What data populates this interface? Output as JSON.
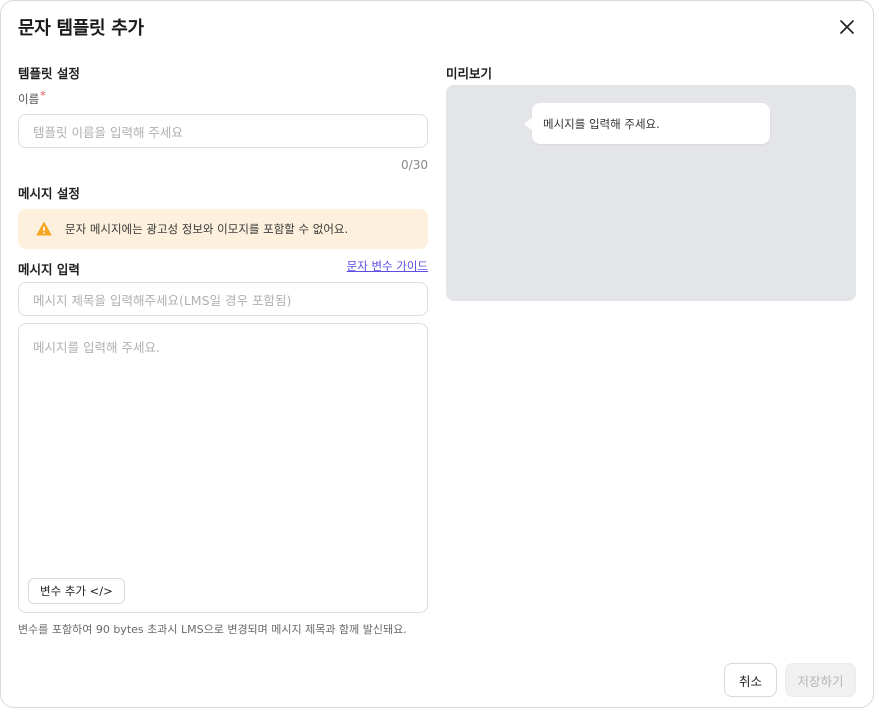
{
  "dialog": {
    "title": "문자 템플릿 추가"
  },
  "template_settings": {
    "heading": "템플릿 설정",
    "name_label": "이름",
    "required_mark": "*",
    "name_placeholder": "템플릿 이름을 입력해 주세요",
    "name_value": "",
    "counter": "0/30"
  },
  "message_settings": {
    "heading": "메시지 설정",
    "notice": "문자 메시지에는 광고성 정보와 이모지를 포함할 수 없어요.",
    "input_heading": "메시지 입력",
    "guide_link": "문자 변수 가이드",
    "subject_placeholder": "메시지 제목을 입력해주세요(LMS일 경우 포함됨)",
    "subject_value": "",
    "body_placeholder": "메시지를 입력해 주세요.",
    "body_value": "",
    "variable_button": "변수 추가 </>",
    "helper_text": "변수를 포함하여 90 bytes 초과시 LMS으로 변경되며 메시지 제목과 함께 발신돼요."
  },
  "preview": {
    "heading": "미리보기",
    "bubble_text": "메시지를 입력해 주세요."
  },
  "footer": {
    "cancel_label": "취소",
    "save_label": "저장하기"
  },
  "icons": {
    "close": "close-icon",
    "warning": "warning-icon"
  },
  "colors": {
    "notice_background": "#fdf0dc",
    "warning_icon": "#f5a623",
    "link": "#5b4ee0",
    "preview_background": "#e4e5e8",
    "required": "#e5484d",
    "disabled_button_text": "#b5b5b5"
  }
}
